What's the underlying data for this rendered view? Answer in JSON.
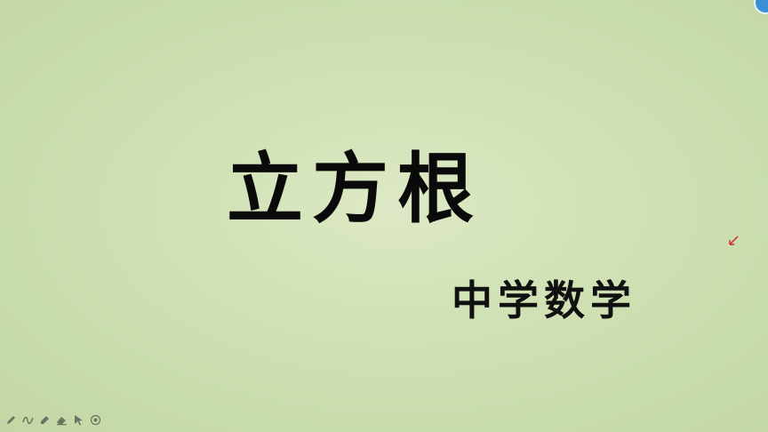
{
  "slide": {
    "title": "立方根",
    "subtitle": "中学数学"
  },
  "toolbar": {
    "tools": [
      {
        "icon": "pen-icon"
      },
      {
        "icon": "freehand-icon"
      },
      {
        "icon": "highlighter-icon"
      },
      {
        "icon": "eraser-icon"
      },
      {
        "icon": "pointer-arrow-icon"
      },
      {
        "icon": "target-icon"
      }
    ]
  },
  "colors": {
    "background": "#cfe0b4",
    "text": "#0a0a0a",
    "laser": "#d22222",
    "badge": "#3a8fd6"
  }
}
